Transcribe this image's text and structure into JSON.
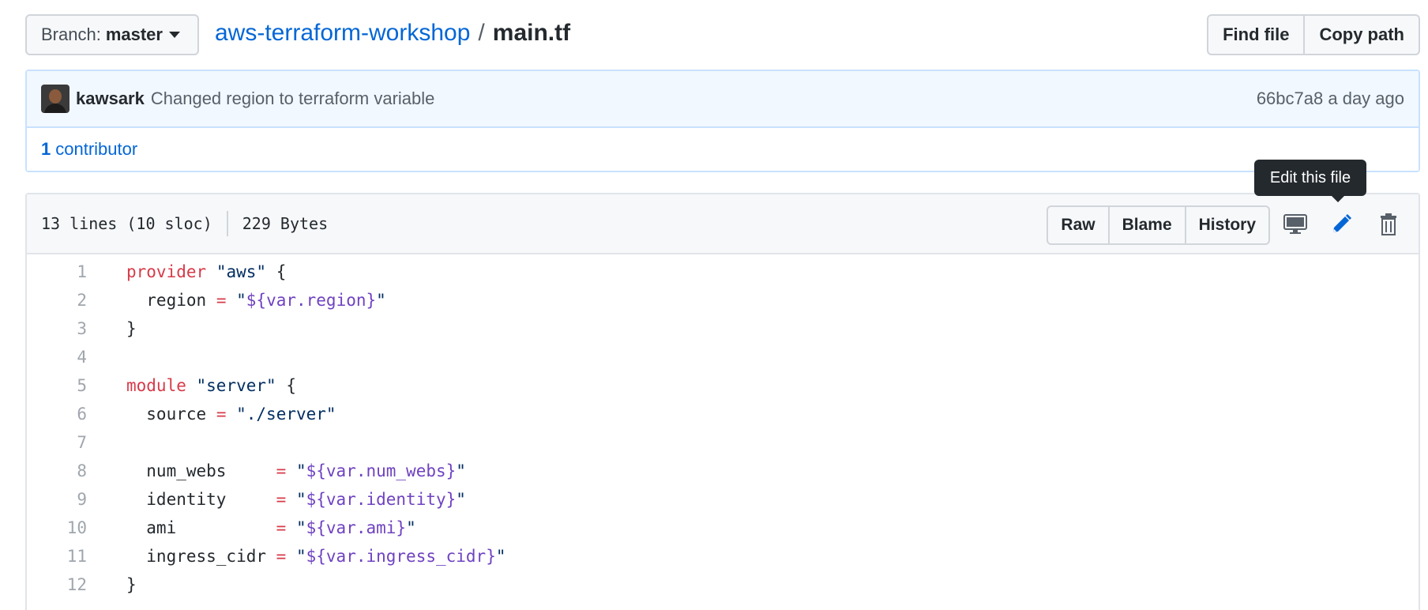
{
  "branch": {
    "prefix": "Branch:",
    "name": "master"
  },
  "breadcrumb": {
    "repo": "aws-terraform-workshop",
    "separator": "/",
    "file": "main.tf"
  },
  "header_buttons": {
    "find_file": "Find file",
    "copy_path": "Copy path"
  },
  "commit": {
    "author": "kawsark",
    "message": "Changed region to terraform variable",
    "sha": "66bc7a8",
    "time": "a day ago"
  },
  "contributors": {
    "count": "1",
    "label": "contributor"
  },
  "file": {
    "lines_info": "13 lines (10 sloc)",
    "size": "229 Bytes",
    "actions": {
      "raw": "Raw",
      "blame": "Blame",
      "history": "History"
    },
    "icons": {
      "desktop": "desktop-icon",
      "edit": "pencil-icon",
      "delete": "trash-icon"
    },
    "tooltip": "Edit this file"
  },
  "code": {
    "line_numbers": [
      "1",
      "2",
      "3",
      "4",
      "5",
      "6",
      "7",
      "8",
      "9",
      "10",
      "11",
      "12"
    ],
    "tokens": {
      "l1_kw": "provider",
      "l1_str": "\"aws\"",
      "l1_brace": "{",
      "l2_key": "  region",
      "l2_eq": "=",
      "l2_q1": "\"",
      "l2_var": "${var.region}",
      "l2_q2": "\"",
      "l3": "}",
      "l5_kw": "module",
      "l5_str": "\"server\"",
      "l5_brace": "{",
      "l6_key": "  source",
      "l6_eq": "=",
      "l6_str": "\"./server\"",
      "l8_key": "  num_webs     ",
      "l8_eq": "=",
      "l8_q1": "\"",
      "l8_var": "${var.num_webs}",
      "l8_q2": "\"",
      "l9_key": "  identity     ",
      "l9_eq": "=",
      "l9_q1": "\"",
      "l9_var": "${var.identity}",
      "l9_q2": "\"",
      "l10_key": "  ami          ",
      "l10_eq": "=",
      "l10_q1": "\"",
      "l10_var": "${var.ami}",
      "l10_q2": "\"",
      "l11_key": "  ingress_cidr ",
      "l11_eq": "=",
      "l11_q1": "\"",
      "l11_var": "${var.ingress_cidr}",
      "l11_q2": "\"",
      "l12": "}"
    }
  },
  "colors": {
    "link": "#0366d6",
    "keyword": "#d73a49",
    "string": "#032f62",
    "variable": "#6f42c1"
  }
}
